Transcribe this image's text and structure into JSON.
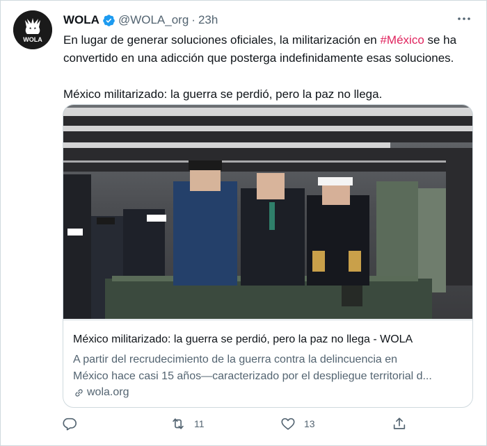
{
  "author": {
    "name": "WOLA",
    "handle": "@WOLA_org",
    "separator": "·",
    "time": "23h",
    "avatar_text": "WOLA"
  },
  "tweet": {
    "line1_before": "En lugar de generar soluciones oficiales, la militarización en ",
    "hashtag": "#México",
    "line1_after": " se ha convertido en una adicción que posterga indefinidamente esas soluciones.",
    "line2": "México militarizado: la guerra se perdió, pero la paz no llega."
  },
  "card": {
    "title": "México militarizado: la guerra se perdió, pero la paz no llega - WOLA",
    "desc_line1": "A partir del recrudecimiento de la guerra contra la delincuencia en",
    "desc_line2": "México hace casi 15 años—caracterizado por el despliegue territorial d...",
    "domain": "wola.org"
  },
  "actions": {
    "reply_count": "",
    "retweet_count": "11",
    "like_count": "13"
  },
  "colors": {
    "hashtag": "#e0245e",
    "verified": "#1d9bf0",
    "secondary_text": "#536471"
  }
}
